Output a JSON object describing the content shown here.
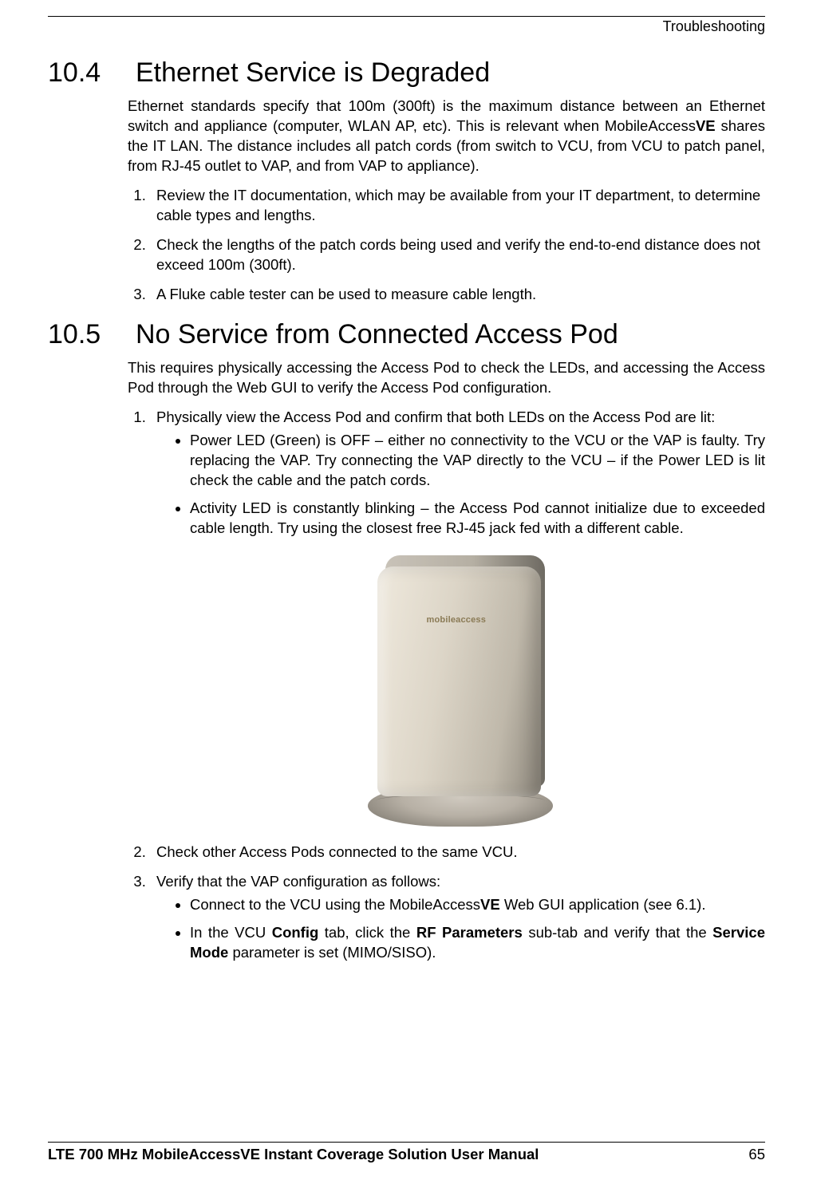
{
  "header": {
    "category": "Troubleshooting"
  },
  "sections": [
    {
      "number": "10.4",
      "title": "Ethernet Service is Degraded",
      "intro_pre": "Ethernet standards specify that 100m (300ft) is the maximum distance between an Ethernet switch and appliance (computer, WLAN AP, etc).  This is relevant when MobileAccess",
      "intro_bold": "VE",
      "intro_post": " shares the IT LAN. The distance includes all patch cords (from switch to VCU, from VCU to patch panel, from RJ-45 outlet to VAP, and from VAP to appliance).",
      "items": [
        "Review the IT documentation, which may be available from your IT department, to determine cable types and lengths.",
        "Check the lengths of the patch cords being used and verify the end-to-end distance does not exceed 100m (300ft).",
        "A Fluke cable tester can be used to measure cable length."
      ]
    },
    {
      "number": "10.5",
      "title": "No Service from Connected Access Pod",
      "intro": "This requires physically accessing the Access Pod to check the LEDs, and accessing the Access Pod through the Web GUI to verify the Access Pod configuration.",
      "item1": "Physically view the Access Pod and confirm that both LEDs on the Access Pod are lit:",
      "bullets1": [
        "Power LED (Green) is OFF – either no connectivity to the VCU or the VAP is faulty. Try replacing the VAP. Try connecting the VAP directly to the VCU – if the Power LED is lit check the cable and the patch cords.",
        "Activity LED is constantly blinking – the Access Pod cannot initialize due to exceeded cable length. Try using the closest free RJ-45 jack fed with a different cable."
      ],
      "item2": "Check other Access Pods connected to the same VCU.",
      "item3": "Verify that the VAP configuration as follows:",
      "bullets3a_pre": "Connect to the VCU using the MobileAccess",
      "bullets3a_bold": "VE",
      "bullets3a_post": " Web GUI application (see 6.1).",
      "bullets3b_pre": "In the VCU ",
      "bullets3b_b1": "Config",
      "bullets3b_mid1": " tab, click the ",
      "bullets3b_b2": "RF Parameters",
      "bullets3b_mid2": " sub-tab and verify that the ",
      "bullets3b_b3": "Service Mode",
      "bullets3b_post": " parameter is set (MIMO/SISO)."
    }
  ],
  "device_logo": "mobileaccess",
  "footer": {
    "title": "LTE 700 MHz MobileAccessVE Instant Coverage Solution User Manual",
    "page": "65"
  }
}
